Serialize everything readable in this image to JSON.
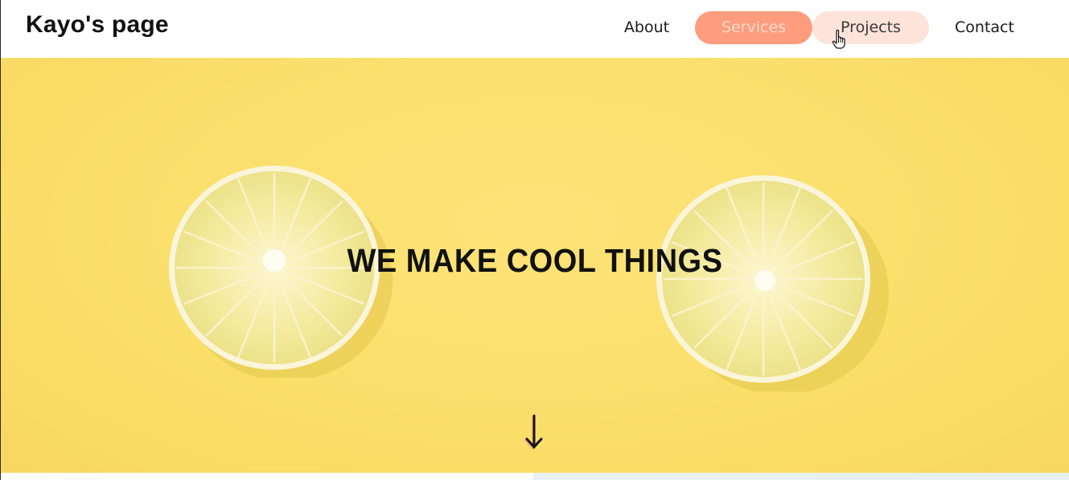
{
  "header": {
    "logo": "Kayo's page",
    "nav": {
      "about": "About",
      "services": "Services",
      "projects": "Projects",
      "contact": "Contact"
    }
  },
  "hero": {
    "title": "WE MAKE COOL THINGS",
    "background_color": "#fbdf6b"
  },
  "colors": {
    "accent": "#fe9d7d",
    "accent_light": "#fde3da"
  },
  "icons": [
    "hand-pointer-cursor-icon",
    "arrow-down-icon"
  ]
}
